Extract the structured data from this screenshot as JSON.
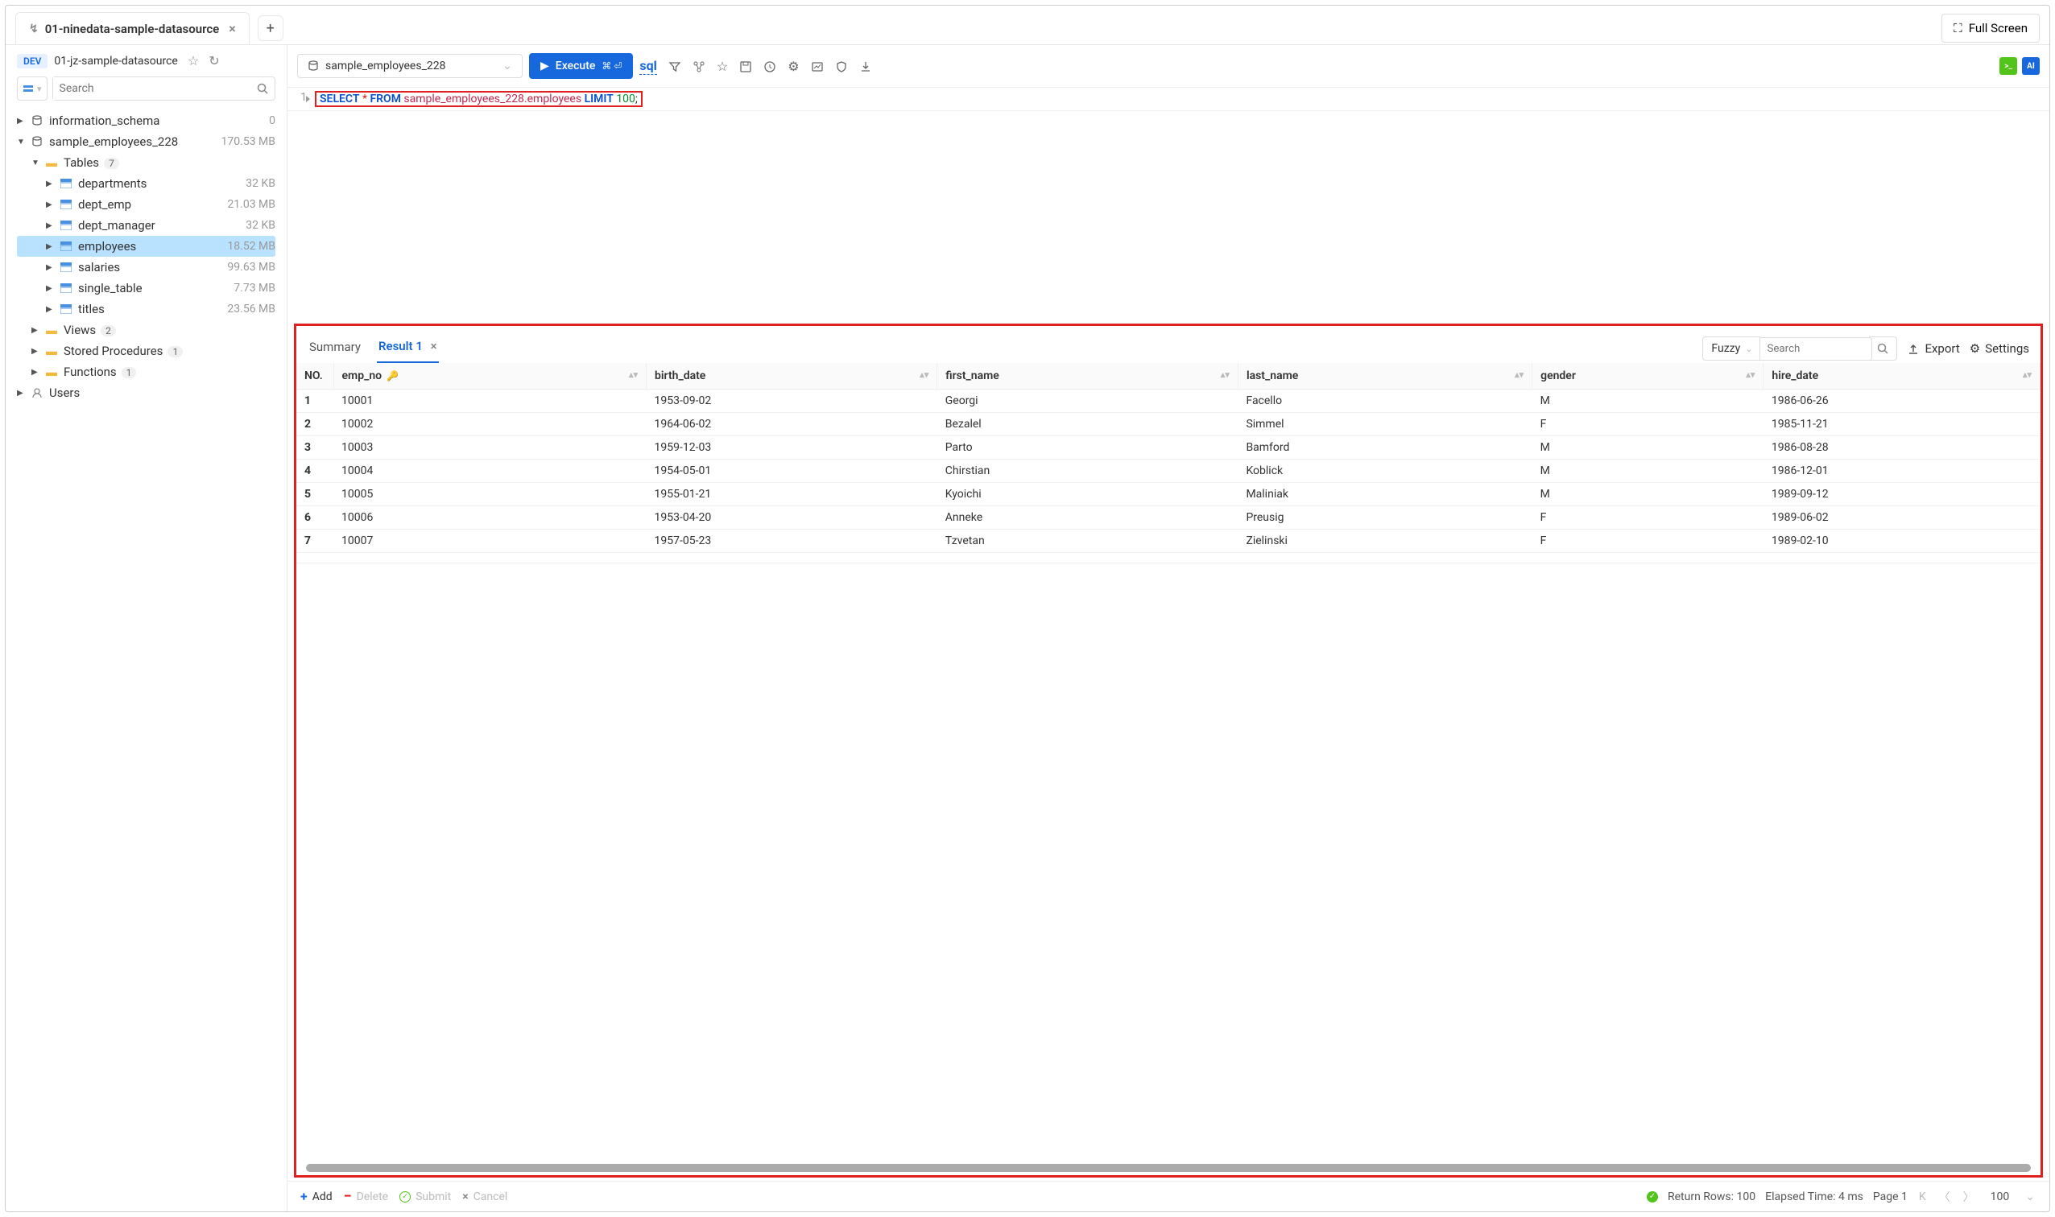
{
  "tab": {
    "title": "01-ninedata-sample-datasource"
  },
  "fullscreen_label": "Full Screen",
  "sidebar": {
    "dev_badge": "DEV",
    "datasource_name": "01-jz-sample-datasource",
    "search_placeholder": "Search",
    "tree": {
      "info_schema": {
        "label": "information_schema",
        "meta": "0"
      },
      "sample_db": {
        "label": "sample_employees_228",
        "meta": "170.53 MB"
      },
      "tables_label": "Tables",
      "tables_count": "7",
      "tables": [
        {
          "label": "departments",
          "meta": "32 KB"
        },
        {
          "label": "dept_emp",
          "meta": "21.03 MB"
        },
        {
          "label": "dept_manager",
          "meta": "32 KB"
        },
        {
          "label": "employees",
          "meta": "18.52 MB"
        },
        {
          "label": "salaries",
          "meta": "99.63 MB"
        },
        {
          "label": "single_table",
          "meta": "7.73 MB"
        },
        {
          "label": "titles",
          "meta": "23.56 MB"
        }
      ],
      "views": {
        "label": "Views",
        "count": "2"
      },
      "procedures": {
        "label": "Stored Procedures",
        "count": "1"
      },
      "functions": {
        "label": "Functions",
        "count": "1"
      },
      "users": {
        "label": "Users"
      }
    }
  },
  "toolbar": {
    "selected_db": "sample_employees_228",
    "execute_label": "Execute",
    "execute_shortcut": "⌘ ⏎"
  },
  "editor": {
    "line_no": "1",
    "sql": {
      "kw1": "SELECT",
      "star": " * ",
      "kw2": "FROM",
      "ident": " sample_employees_228.employees ",
      "kw3": "LIMIT",
      "num": " 100",
      "semi": ";"
    }
  },
  "results": {
    "tabs": {
      "summary": "Summary",
      "result1": "Result 1"
    },
    "fuzzy_label": "Fuzzy",
    "search_placeholder": "Search",
    "export_label": "Export",
    "settings_label": "Settings",
    "columns": [
      "NO.",
      "emp_no",
      "birth_date",
      "first_name",
      "last_name",
      "gender",
      "hire_date"
    ],
    "rows": [
      [
        "1",
        "10001",
        "1953-09-02",
        "Georgi",
        "Facello",
        "M",
        "1986-06-26"
      ],
      [
        "2",
        "10002",
        "1964-06-02",
        "Bezalel",
        "Simmel",
        "F",
        "1985-11-21"
      ],
      [
        "3",
        "10003",
        "1959-12-03",
        "Parto",
        "Bamford",
        "M",
        "1986-08-28"
      ],
      [
        "4",
        "10004",
        "1954-05-01",
        "Chirstian",
        "Koblick",
        "M",
        "1986-12-01"
      ],
      [
        "5",
        "10005",
        "1955-01-21",
        "Kyoichi",
        "Maliniak",
        "M",
        "1989-09-12"
      ],
      [
        "6",
        "10006",
        "1953-04-20",
        "Anneke",
        "Preusig",
        "F",
        "1989-06-02"
      ],
      [
        "7",
        "10007",
        "1957-05-23",
        "Tzvetan",
        "Zielinski",
        "F",
        "1989-02-10"
      ],
      [
        "",
        "",
        "",
        "",
        "",
        "",
        ""
      ]
    ]
  },
  "footer": {
    "add": "Add",
    "delete": "Delete",
    "submit": "Submit",
    "cancel": "Cancel",
    "return_rows": "Return Rows: 100",
    "elapsed": "Elapsed Time: 4 ms",
    "page": "Page 1",
    "count": "100"
  }
}
